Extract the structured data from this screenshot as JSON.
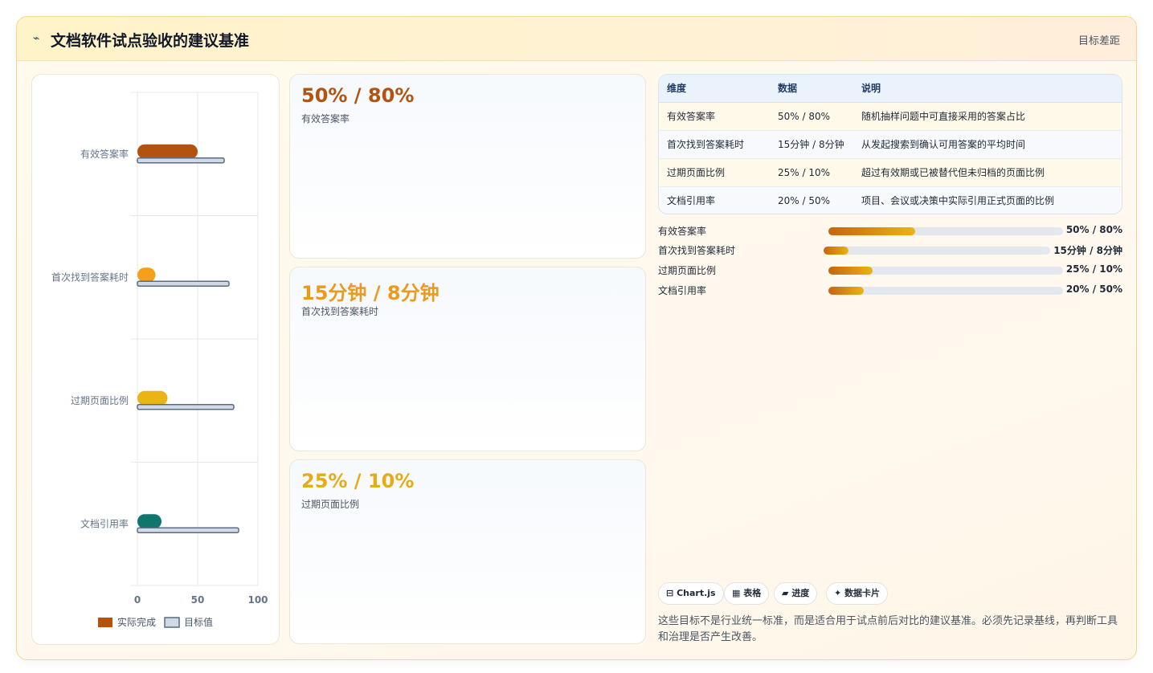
{
  "header": {
    "icon": "⌁",
    "title": "文档软件试点验收的建议基准",
    "right_label": "目标差距"
  },
  "chart_data": {
    "type": "bar",
    "orientation": "horizontal",
    "categories": [
      "有效答案率",
      "首次找到答案耗时",
      "过期页面比例",
      "文档引用率"
    ],
    "series": [
      {
        "name": "实际完成",
        "values": [
          50,
          15,
          25,
          20
        ],
        "colors": [
          "#b4530f",
          "#f59f1b",
          "#eab414",
          "#0f766e"
        ]
      },
      {
        "name": "目标值",
        "values": [
          72,
          76,
          80,
          84
        ],
        "color": "#cfdae6"
      }
    ],
    "xlim": [
      0,
      100
    ],
    "xticks": [
      0,
      50,
      100
    ],
    "grid": true,
    "legend": "bottom"
  },
  "kpis": [
    {
      "value": "50% / 80%",
      "label": "有效答案率",
      "color": "#b4530f"
    },
    {
      "value": "15分钟 / 8分钟",
      "label": "首次找到答案耗时",
      "color": "#ec9a1d"
    },
    {
      "value": "25% / 10%",
      "label": "过期页面比例",
      "color": "#e6ab15"
    }
  ],
  "table": {
    "headers": [
      "维度",
      "数据",
      "说明"
    ],
    "rows": [
      [
        "有效答案率",
        "50% / 80%",
        "随机抽样问题中可直接采用的答案占比"
      ],
      [
        "首次找到答案耗时",
        "15分钟 / 8分钟",
        "从发起搜索到确认可用答案的平均时间"
      ],
      [
        "过期页面比例",
        "25% / 10%",
        "超过有效期或已被替代但未归档的页面比例"
      ],
      [
        "文档引用率",
        "20% / 50%",
        "项目、会议或决策中实际引用正式页面的比例"
      ]
    ]
  },
  "progress": [
    {
      "label": "有效答案率",
      "value": "50% / 80%",
      "fraction": 0.37
    },
    {
      "label": "首次找到答案耗时",
      "value": "15分钟 / 8分钟",
      "fraction": 0.11
    },
    {
      "label": "过期页面比例",
      "value": "25% / 10%",
      "fraction": 0.19
    },
    {
      "label": "文档引用率",
      "value": "20% / 50%",
      "fraction": 0.15
    }
  ],
  "chips": [
    {
      "icon": "⊟",
      "label": "Chart.js"
    },
    {
      "icon": "▦",
      "label": "表格"
    },
    {
      "icon": "▰",
      "label": "进度"
    },
    {
      "icon": "✦",
      "label": "数据卡片"
    }
  ],
  "note": "这些目标不是行业统一标准，而是适合用于试点前后对比的建议基准。必须先记录基线，再判断工具和治理是否产生改善。"
}
